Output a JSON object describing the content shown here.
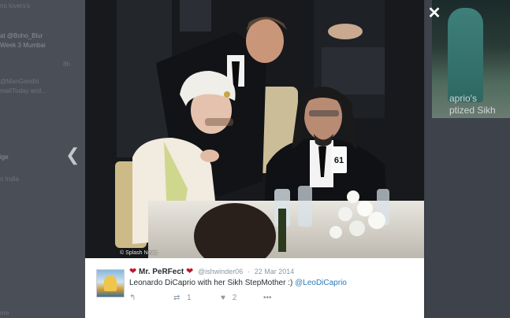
{
  "background": {
    "left_snippets": [
      {
        "text": "no lovers's",
        "dim": true
      },
      {
        "text": "at @Boho_Blur",
        "dim": false
      },
      {
        "text": "Week 3 Mumbai",
        "dim": false
      },
      {
        "text": "8h",
        "dim": true
      },
      {
        "text": "@ManGandhi",
        "dim": true
      },
      {
        "text": "malIToday and...",
        "dim": true
      },
      {
        "text": "ige",
        "dim": false
      },
      {
        "text": "n India",
        "dim": true
      },
      {
        "text": "ore",
        "dim": true
      }
    ],
    "right_caption_line1": "aprio's",
    "right_caption_line2": "ptized Sikh"
  },
  "media": {
    "credit": "© Splash News",
    "card_number": "61"
  },
  "tweet": {
    "display_name": "Mr. PeRFect",
    "handle": "@ishwinder06",
    "separator": "·",
    "date": "22 Mar 2014",
    "text": "Leonardo DiCaprio with her Sikh StepMother :)",
    "mention": "@LeoDiCaprio",
    "retweet_count": "1",
    "like_count": "2",
    "more_label": "•••"
  },
  "icons": {
    "close": "close-icon",
    "prev": "chevron-left-icon",
    "reply": "reply-icon",
    "retweet": "retweet-icon",
    "like": "heart-icon",
    "more": "more-icon"
  },
  "colors": {
    "heart": "#c0152b",
    "mention": "#2b7bb9",
    "meta": "#8899a6"
  }
}
